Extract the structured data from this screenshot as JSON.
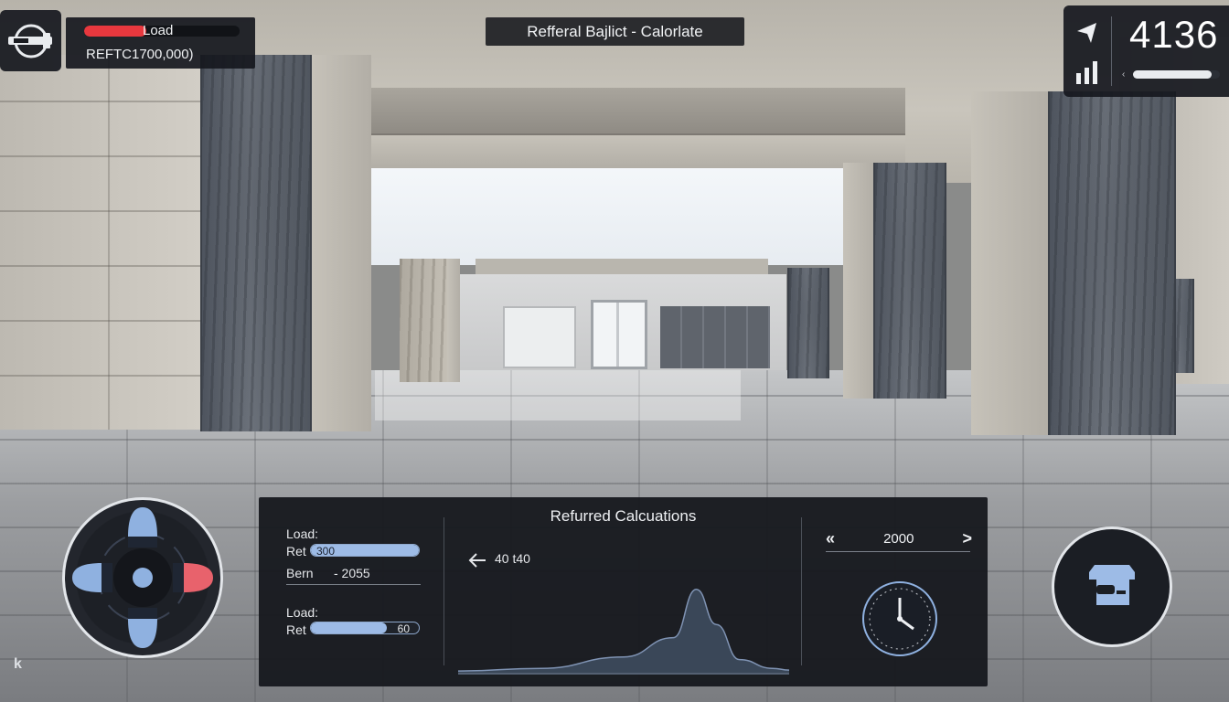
{
  "hud": {
    "load_label": "Load",
    "load_fraction": 0.4,
    "load_value": "REFTC1700,000)",
    "title": "Refferal Bajlict - Calorlate",
    "stats_number": "4136",
    "stats_slider_fraction": 0.9,
    "corner_mark": "k"
  },
  "icons": {
    "tool": "rifle-tool-icon",
    "alert": "alert-icon",
    "signal": "signal-bars-icon",
    "joystick": "dpad-icon",
    "graph_back": "arrow-left-icon",
    "clock": "clock-gauge-icon",
    "action": "map-scroll-icon"
  },
  "panel": {
    "title": "Refurred Calcuations",
    "row1_label": "Load:",
    "row1_sub": "Ret",
    "row1_value": "300",
    "row1_fraction": 1.0,
    "row2_label": "Bern",
    "row2_value": "- 2055",
    "row3_label": "Load:",
    "row3_sub": "Ret",
    "row3_value": "60",
    "row3_fraction": 0.7,
    "graph_readout": "40 t40",
    "year_prev": "«",
    "year_value": "2000",
    "year_next": ">"
  },
  "chart_data": {
    "type": "area",
    "x": [
      0,
      0.25,
      0.5,
      0.65,
      0.72,
      0.78,
      0.85,
      0.95,
      1
    ],
    "values": [
      0.02,
      0.05,
      0.18,
      0.4,
      0.95,
      0.55,
      0.15,
      0.05,
      0.03
    ],
    "title": "",
    "xlabel": "",
    "ylabel": "",
    "grid": false
  },
  "colors": {
    "hud_bg": "#16181e",
    "load_red": "#e8383e",
    "bar_blue": "#9dbbe6",
    "joystick_blue": "#8fb1e0",
    "joystick_red": "#e8626c",
    "graph_fill": "#3a4758"
  }
}
